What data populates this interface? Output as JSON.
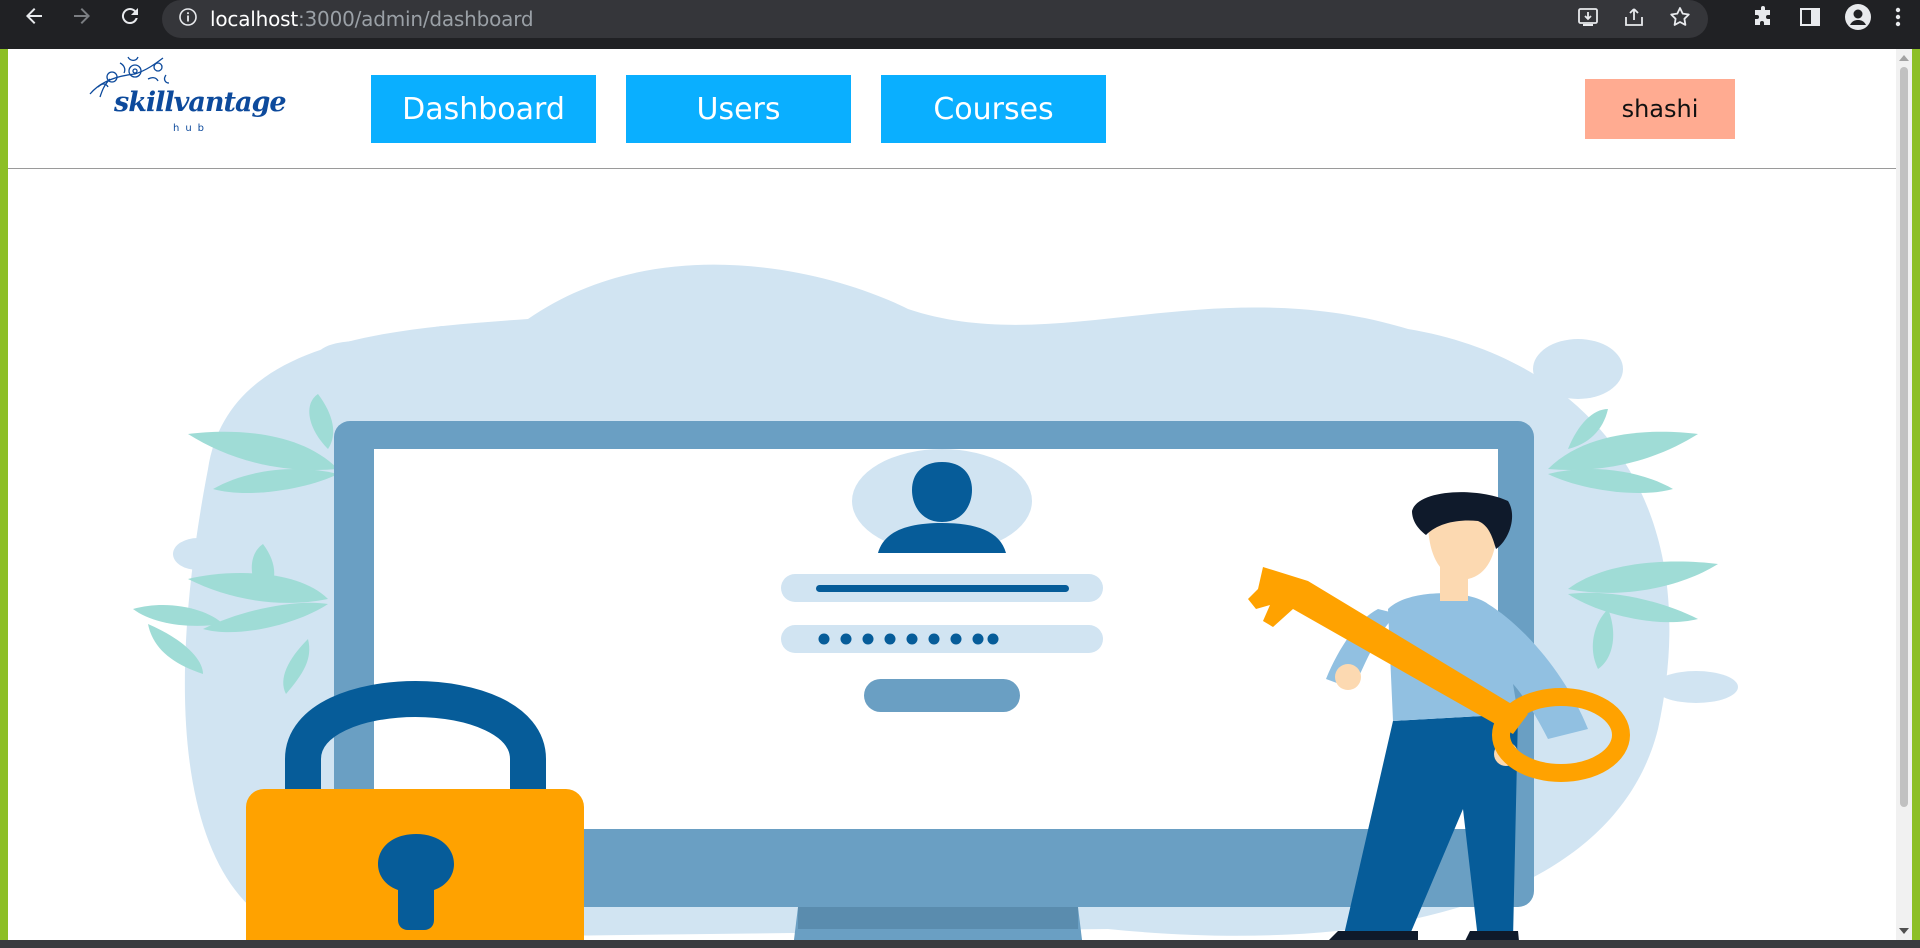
{
  "browser": {
    "url_host": "localhost",
    "url_path": ":3000/admin/dashboard"
  },
  "brand": {
    "logo_text": "skillvantage",
    "logo_sub": "hub"
  },
  "nav": {
    "dashboard": "Dashboard",
    "users": "Users",
    "courses": "Courses"
  },
  "user": {
    "name": "shashi"
  },
  "colors": {
    "nav_button": "#0aafff",
    "user_button": "#ffab91",
    "brand": "#0d4a9c"
  }
}
